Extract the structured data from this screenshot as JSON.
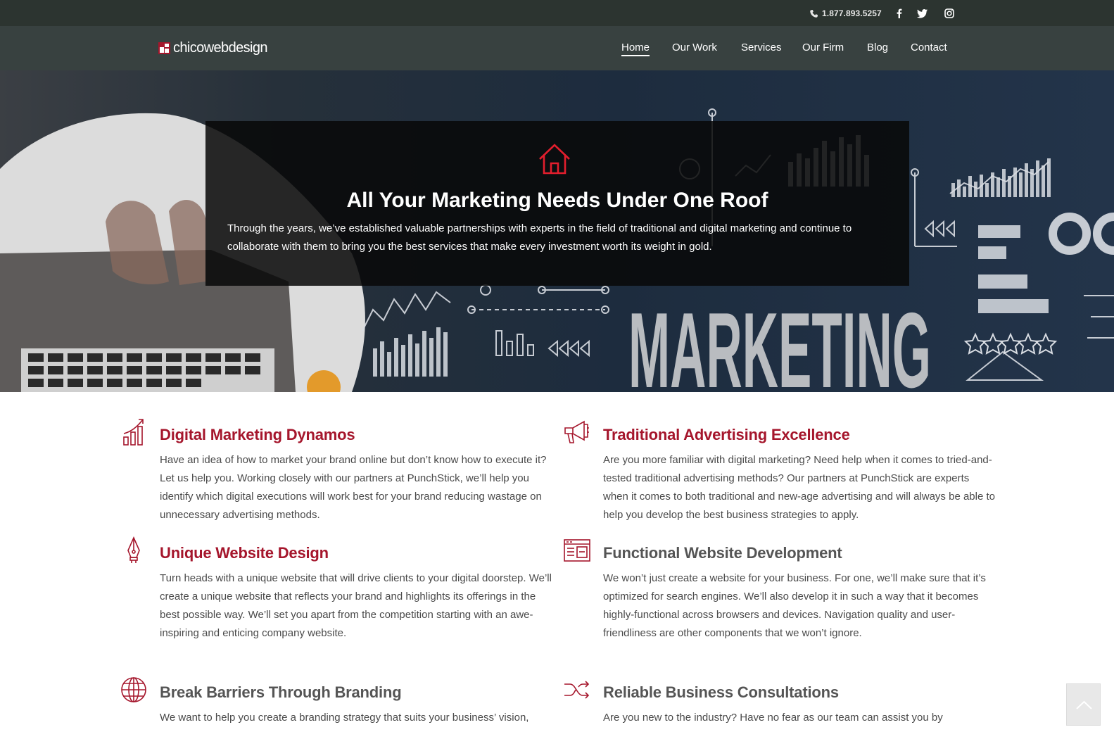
{
  "topbar": {
    "phone": "1.877.893.5257",
    "social": [
      {
        "name": "facebook-icon"
      },
      {
        "name": "twitter-icon"
      },
      {
        "name": "instagram-icon"
      }
    ]
  },
  "nav": {
    "logo": "chicowebdesign",
    "items": [
      {
        "label": "Home",
        "active": true
      },
      {
        "label": "Our Work"
      },
      {
        "label": "Services"
      },
      {
        "label": "Our Firm"
      },
      {
        "label": "Blog"
      },
      {
        "label": "Contact"
      }
    ]
  },
  "hero": {
    "icon": "house-icon",
    "title": "All Your Marketing Needs Under One Roof",
    "text": "Through the years, we’ve established valuable partnerships with experts in the field of traditional and digital marketing and continue to collaborate with them to bring you the best services that make every investment worth its weight in gold.",
    "image_text": "MARKETING"
  },
  "services": [
    {
      "title": "Digital Marketing Dynamos",
      "icon": "bar-chart-icon",
      "text": "Have an idea of how to market your brand online but don’t know how to execute it? Let us help you. Working closely with our partners at PunchStick, we’ll help you identify which digital executions will work best for your brand reducing wastage on unnecessary advertising methods."
    },
    {
      "title": "Traditional Advertising Excellence",
      "icon": "megaphone-icon",
      "text": "Are you more familiar with digital marketing? Need help when it comes to tried-and-tested traditional advertising methods? Our partners at PunchStick are experts when it comes to both traditional and new-age advertising and will always be able to help you develop the best business strategies to apply."
    },
    {
      "title": "Unique Website Design",
      "icon": "pen-nib-icon",
      "text": "Turn heads with a unique website that will drive clients to your digital doorstep. We’ll create a unique website that reflects your brand and highlights its offerings in the best possible way. We’ll set you apart from the competition starting with an awe-inspiring and enticing company website."
    },
    {
      "title": "Functional Website Development",
      "icon": "browser-window-icon",
      "text": "We won’t just create a website for your business. For one, we’ll make sure that it’s optimized for search engines. We’ll also develop it in such a way that it becomes highly-functional across browsers and devices. Navigation quality and user-friendliness are other components that we won’t ignore."
    },
    {
      "title": "Break Barriers Through Branding",
      "icon": "globe-icon",
      "text": "We want to help you create a branding strategy that suits your business’ vision,"
    },
    {
      "title": "Reliable Business Consultations",
      "icon": "shuffle-icon",
      "text": "Are you new to the industry? Have no fear as our team can assist you by"
    }
  ],
  "colors": {
    "accent": "#a5162c",
    "topbar": "#2c3430",
    "navbar": "#384140"
  }
}
